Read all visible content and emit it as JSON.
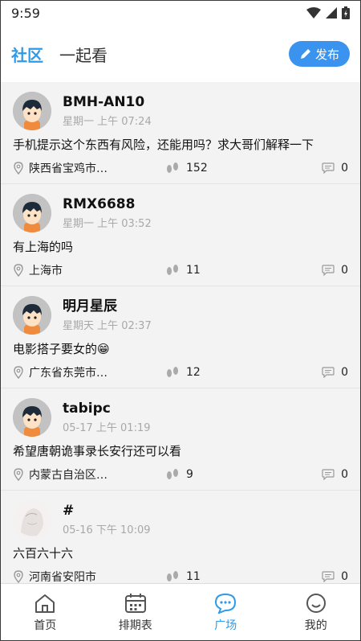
{
  "status_bar": {
    "time": "9:59"
  },
  "header": {
    "tabs": [
      {
        "label": "社区",
        "active": true
      },
      {
        "label": "一起看",
        "active": false
      }
    ],
    "publish_label": "发布"
  },
  "posts": [
    {
      "username": "BMH-AN10",
      "time": "星期一 上午 07:24",
      "content": "手机提示这个东西有风险，还能用吗？求大哥们解释一下",
      "location": "陕西省宝鸡市…",
      "views": "152",
      "comments": "0",
      "avatar": "cartoon-boy"
    },
    {
      "username": "RMX6688",
      "time": "星期一 上午 03:52",
      "content": "有上海的吗",
      "location": "上海市",
      "views": "11",
      "comments": "0",
      "avatar": "cartoon-boy"
    },
    {
      "username": "明月星辰",
      "time": "星期天 上午 02:37",
      "content": "电影搭子要女的😁",
      "location": "广东省东莞市…",
      "views": "12",
      "comments": "0",
      "avatar": "cartoon-boy"
    },
    {
      "username": "tabipc",
      "time": "05-17 上午 01:19",
      "content": "希望唐朝诡事录长安行还可以看",
      "location": "内蒙古自治区…",
      "views": "9",
      "comments": "0",
      "avatar": "cartoon-boy"
    },
    {
      "username": "#",
      "time": "05-16 下午 10:09",
      "content": "六百六十六",
      "location": "河南省安阳市",
      "views": "11",
      "comments": "0",
      "avatar": "sketch-girl"
    }
  ],
  "bottom_nav": [
    {
      "label": "首页",
      "icon": "home-icon",
      "active": false
    },
    {
      "label": "排期表",
      "icon": "calendar-icon",
      "active": false
    },
    {
      "label": "广场",
      "icon": "chat-bubble-icon",
      "active": true
    },
    {
      "label": "我的",
      "icon": "smiley-icon",
      "active": false
    }
  ],
  "colors": {
    "accent": "#2f9be8",
    "publish_bg": "#3a93ee",
    "feed_bg": "#f3f3f3"
  }
}
